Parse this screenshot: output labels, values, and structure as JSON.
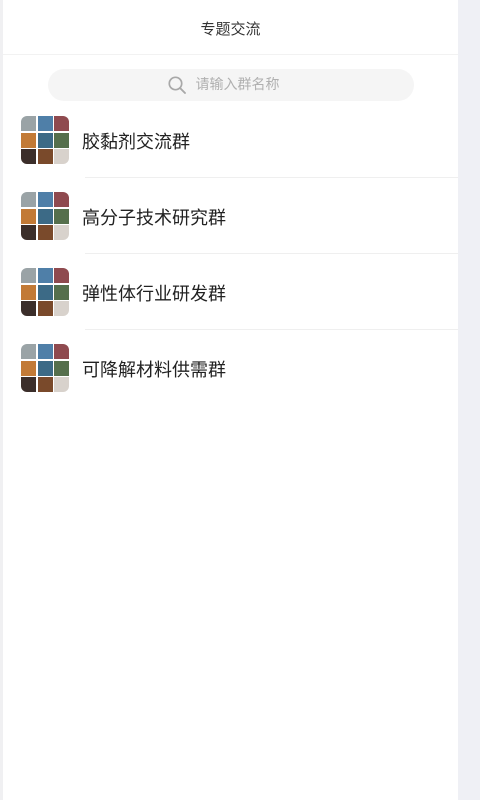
{
  "header": {
    "title": "专题交流"
  },
  "search": {
    "placeholder": "请输入群名称",
    "icon": "search-icon"
  },
  "groups": [
    {
      "name": "胶黏剂交流群"
    },
    {
      "name": "高分子技术研究群"
    },
    {
      "name": "弹性体行业研发群"
    },
    {
      "name": "可降解材料供需群"
    }
  ],
  "colors": {
    "background": "#eeeff3",
    "panel": "#ffffff",
    "search_bg": "#f5f5f5",
    "text": "#222222",
    "placeholder": "#b0b0b0"
  }
}
